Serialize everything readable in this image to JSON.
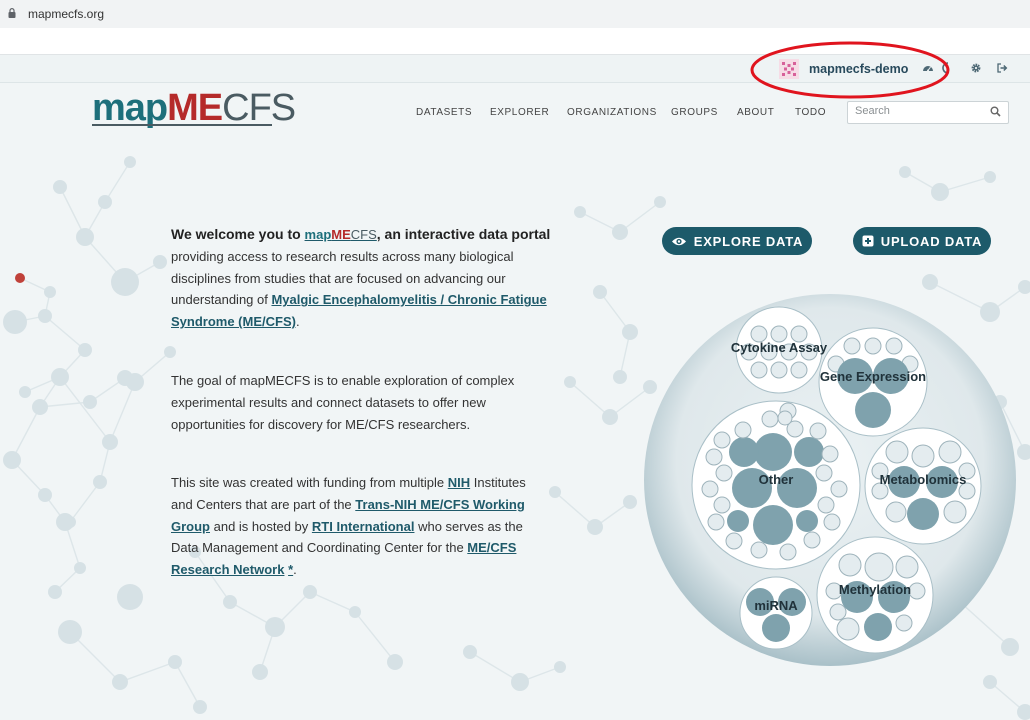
{
  "browser": {
    "url": "mapmecfs.org"
  },
  "topbar": {
    "username": "mapmecfs-demo",
    "icons": [
      "avatar-icon",
      "dashboard-icon",
      "settings-icon",
      "logout-icon"
    ]
  },
  "logo": {
    "part1": "map",
    "part2": "ME",
    "part3": "CFS"
  },
  "nav": {
    "items": [
      "DATASETS",
      "EXPLORER",
      "ORGANIZATIONS",
      "GROUPS",
      "ABOUT",
      "TODO"
    ],
    "search_placeholder": "Search"
  },
  "intro": {
    "p1_a": "We welcome you to ",
    "p1_logo1": "map",
    "p1_logo2": "ME",
    "p1_logo3": "CFS",
    "p1_b": ", an interactive data portal",
    "p1_c": " providing access to research results across many biological disciplines from studies that are focused on advancing our understanding of ",
    "p1_link": "Myalgic Encephalomyelitis / Chronic Fatigue Syndrome (ME/CFS)",
    "p1_d": ".",
    "p2": "The goal of mapMECFS is to enable exploration of complex experimental results and connect datasets to offer new opportunities for discovery for ME/CFS researchers.",
    "p3_a": "This site was created with funding from multiple ",
    "p3_link1": "NIH",
    "p3_b": " Institutes and Centers that are part of the ",
    "p3_link2": "Trans-NIH ME/CFS Working Group",
    "p3_c": " and is hosted by ",
    "p3_link3": "RTI International",
    "p3_d": " who serves as the Data Management and Coordinating Center for the ",
    "p3_link4": "ME/CFS Research Network",
    "p3_e": " ",
    "p3_ast": "*",
    "p3_f": "."
  },
  "buttons": {
    "explore": "EXPLORE DATA",
    "upload": "UPLOAD DATA"
  },
  "bubble_chart": {
    "groups": [
      "Cytokine Assay",
      "Gene Expression",
      "Other",
      "Metabolomics",
      "miRNA",
      "Methylation"
    ]
  },
  "colors": {
    "brand_teal": "#1d6f7b",
    "brand_red": "#b52a2a",
    "button_bg": "#1d5a6a",
    "link": "#1f5a6a"
  }
}
